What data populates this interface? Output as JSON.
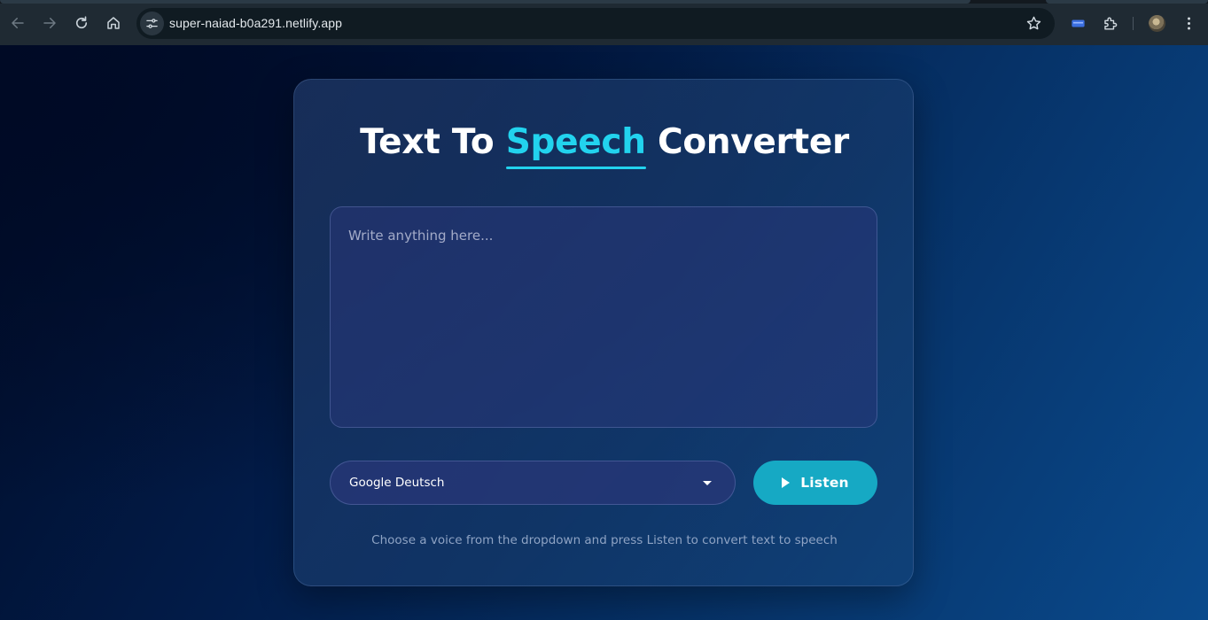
{
  "browser": {
    "url": "super-naiad-b0a291.netlify.app",
    "icons": {
      "back": "arrow-left-icon",
      "forward": "arrow-right-icon",
      "reload": "reload-icon",
      "home": "home-icon",
      "site_info": "tune-icon",
      "bookmark": "star-icon",
      "extension_active": "blue-rectangle-icon",
      "extensions": "puzzle-icon",
      "menu": "kebab-menu-icon"
    }
  },
  "app": {
    "title_part1": "Text To ",
    "title_accent": "Speech",
    "title_part2": " Converter",
    "textarea_placeholder": "Write anything here...",
    "textarea_value": "",
    "voice_selected": "Google Deutsch",
    "listen_label": "Listen",
    "hint": "Choose a voice from the dropdown and press Listen to convert text to speech"
  },
  "colors": {
    "accent": "#22d3ee",
    "button": "#16a9c4",
    "background_dark": "#000b26",
    "background_light": "#0a4a8c"
  }
}
